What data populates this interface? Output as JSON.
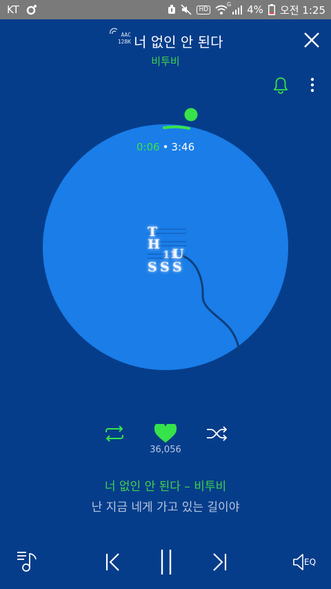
{
  "status_bar": {
    "carrier": "KT",
    "hd_label": "HD",
    "network_label": "G",
    "battery": "4%",
    "time": "오전 1:25"
  },
  "header": {
    "quality_codec": "AAC",
    "quality_bitrate": "128K",
    "song_title": "너 없인 안 된다",
    "artist": "비투비"
  },
  "player": {
    "elapsed": "0:06",
    "total": "3:46",
    "progress_fraction": 0.027,
    "like_count": "36,056",
    "liked": true
  },
  "lyrics": {
    "title_line": "너 없인 안 된다 – 비투비",
    "current_line": "난 지금 네게 가고 있는 길이야"
  },
  "bottom_bar": {
    "eq_label": "EQ"
  },
  "colors": {
    "background": "#063d8a",
    "disc": "#1a7de8",
    "accent_green": "#37e34a",
    "status_bar": "#7a7a7a"
  }
}
